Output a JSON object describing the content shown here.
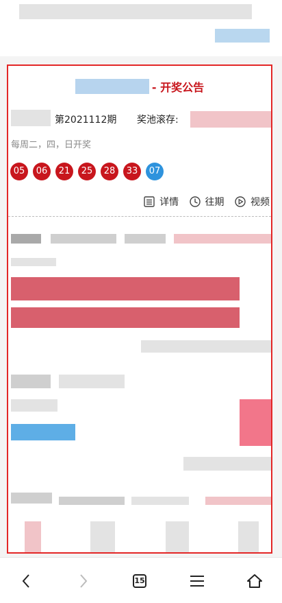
{
  "card": {
    "title_suffix": "- 开奖公告",
    "issue": "第2021112期",
    "pool_label": "奖池滚存:",
    "schedule": "每周二，四，日开奖"
  },
  "balls": {
    "red": [
      "05",
      "06",
      "21",
      "25",
      "28",
      "33"
    ],
    "blue": [
      "07"
    ]
  },
  "actions": {
    "details": "详情",
    "history": "往期",
    "video": "视频"
  },
  "nav": {
    "tab_count": "15"
  },
  "colors": {
    "accent_red": "#c8161d",
    "blue_ball": "#2e93dd",
    "highlight_border": "#e32626"
  }
}
